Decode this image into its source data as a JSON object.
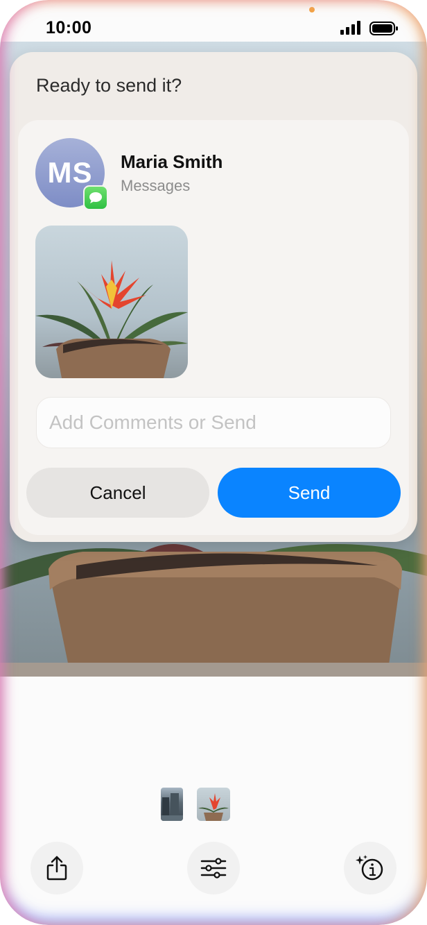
{
  "status_bar": {
    "time": "10:00"
  },
  "sheet": {
    "title": "Ready to send it?",
    "contact": {
      "initials": "MS",
      "name": "Maria Smith",
      "app": "Messages"
    },
    "comment_placeholder": "Add Comments or Send",
    "cancel_label": "Cancel",
    "send_label": "Send"
  },
  "colors": {
    "accent": "#0a84ff",
    "messages_green": "#34c759"
  },
  "toolbar": {
    "icons": [
      "share-icon",
      "sliders-icon",
      "visual-lookup-info-icon"
    ]
  }
}
